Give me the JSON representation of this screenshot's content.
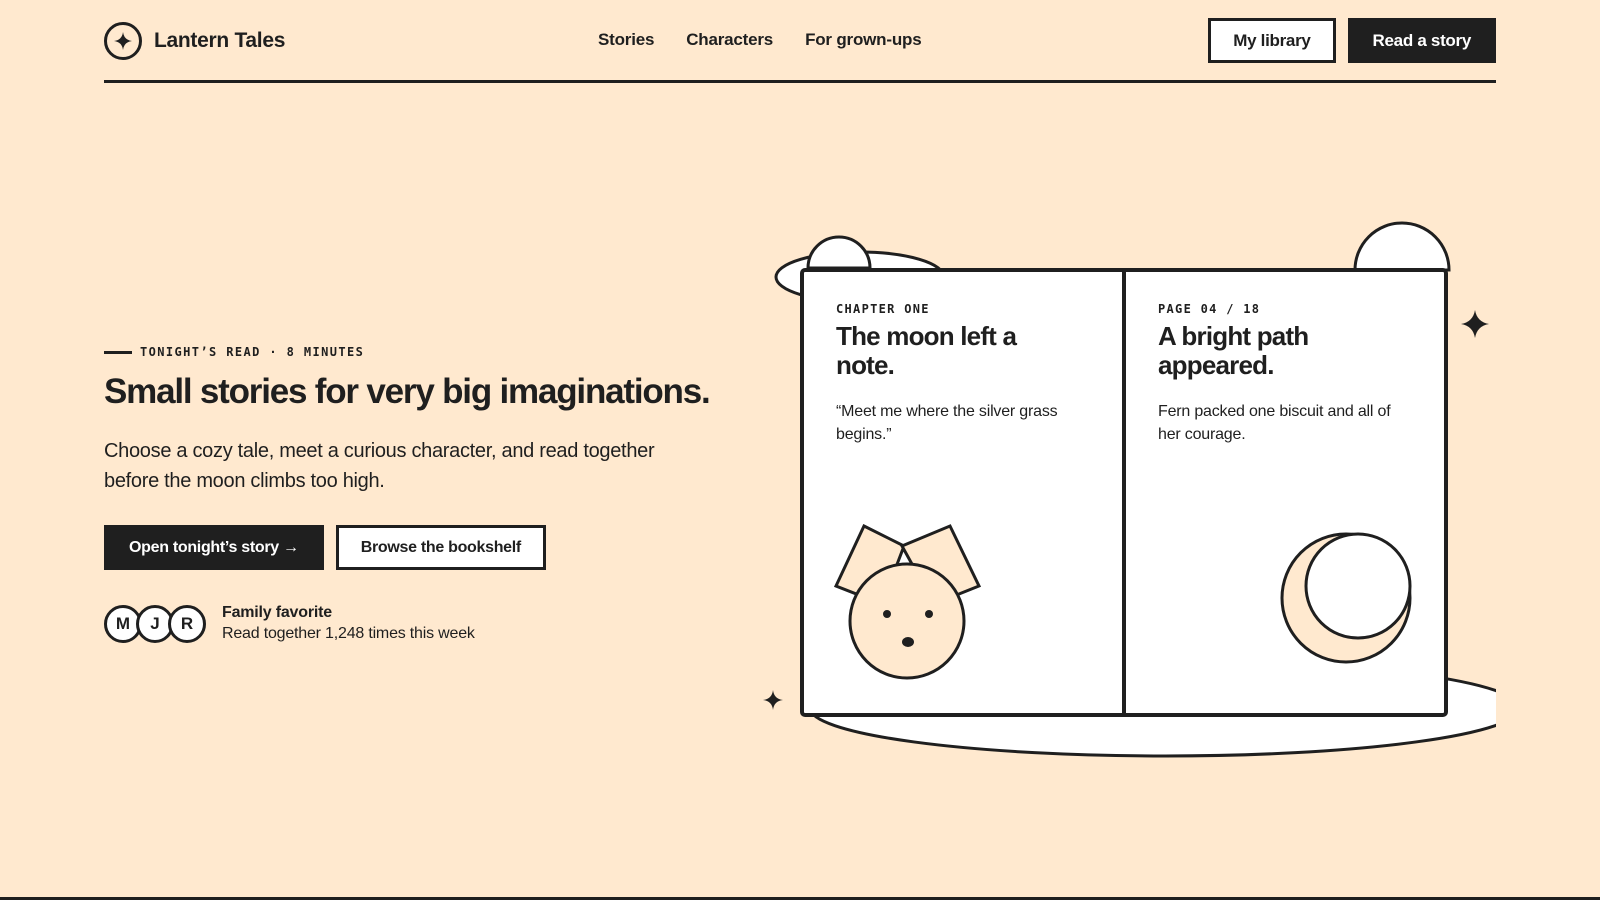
{
  "brand": {
    "name": "Lantern Tales",
    "icon": "sparkle-icon"
  },
  "nav": {
    "links": [
      "Stories",
      "Characters",
      "For grown-ups"
    ],
    "my_library": "My library",
    "read_story": "Read a story"
  },
  "hero": {
    "eyebrow": "TONIGHT’S READ · 8 MINUTES",
    "headline": "Small stories for very big imaginations.",
    "subline": "Choose a cozy tale, meet a curious character, and read together before the moon climbs too high.",
    "primary_cta": "Open tonight’s story →",
    "secondary_cta": "Browse the bookshelf"
  },
  "social": {
    "avatars": [
      "M",
      "J",
      "R"
    ],
    "title": "Family favorite",
    "subtitle": "Read together 1,248 times this week"
  },
  "book": {
    "left": {
      "label": "CHAPTER ONE",
      "title": "The moon left a note.",
      "text": "“Meet me where the silver grass begins.”"
    },
    "right": {
      "label": "PAGE 04 / 18",
      "title": "A bright path appeared.",
      "text": "Fern packed one biscuit and all of her courage."
    }
  },
  "colors": {
    "background": "#ffe9cf",
    "ink": "#1f1f1f",
    "paper": "#ffffff"
  }
}
